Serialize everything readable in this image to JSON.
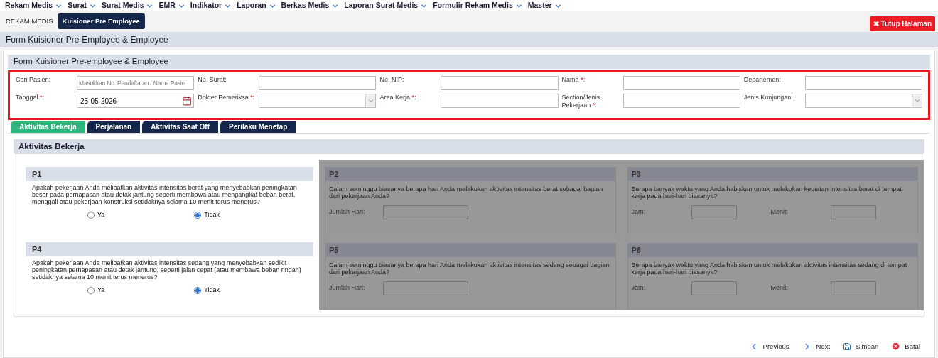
{
  "menu": [
    {
      "label": "Rekam Medis"
    },
    {
      "label": "Surat"
    },
    {
      "label": "Surat Medis"
    },
    {
      "label": "EMR"
    },
    {
      "label": "Indikator"
    },
    {
      "label": "Laporan"
    },
    {
      "label": "Berkas Medis"
    },
    {
      "label": "Laporan Surat Medis"
    },
    {
      "label": "Formulir Rekam Medis"
    },
    {
      "label": "Master"
    }
  ],
  "breadcrumb": [
    {
      "label": "REKAM MEDIS",
      "selected": false
    },
    {
      "label": "Kuisioner Pre Employee",
      "selected": true
    }
  ],
  "close_button": {
    "icon": "✖",
    "label": "Tutup Halaman"
  },
  "page_title": "Form Kuisioner Pre-Employee & Employee",
  "form": {
    "title": "Form Kuisioner Pre-employee & Employee",
    "rows": [
      [
        {
          "label": "Cari Pasien:",
          "kind": "text",
          "placeholder": "Masukkan No. Pendaftaran / Nama Pasie"
        },
        {
          "label": "No. Surat:",
          "kind": "text"
        },
        {
          "label": "No. NIP:",
          "kind": "text"
        },
        {
          "label": "Nama ",
          "mark": "*",
          "suffix": ":",
          "kind": "text"
        },
        {
          "label": "Departemen:",
          "kind": "text"
        }
      ],
      [
        {
          "label": "Tanggal ",
          "mark": "*",
          "suffix": ":",
          "kind": "date",
          "value": "25-05-2026"
        },
        {
          "label": "Dokter Pemeriksa ",
          "mark": "*",
          "suffix": ":",
          "kind": "select"
        },
        {
          "label": "Area Kerja ",
          "mark": "*",
          "suffix": ":",
          "kind": "text"
        },
        {
          "label": "Section/Jenis Pekerjaan ",
          "mark": "*",
          "suffix": ":",
          "kind": "text"
        },
        {
          "label": "Jenis Kunjungan:",
          "kind": "select"
        }
      ]
    ]
  },
  "tabs": [
    {
      "label": "Aktivitas Bekerja",
      "selected": true
    },
    {
      "label": "Perjalanan",
      "selected": false
    },
    {
      "label": "Aktivitas Saat Off",
      "selected": false
    },
    {
      "label": "Perilaku Menetap",
      "selected": false
    }
  ],
  "section": {
    "title": "Aktivitas Bekerja",
    "left": [
      {
        "code": "P1",
        "text": "Apakah pekerjaan Anda melibatkan aktivitas intensitas berat yang menyebabkan peningkatan besar pada pernapasan atau detak jantung seperti membawa atau mengangkat beban berat, menggali atau pekerjaan konstruksi setidaknya selama 10 menit terus menerus?",
        "options": [
          {
            "label": "Ya",
            "selected": false
          },
          {
            "label": "Tidak",
            "selected": true
          }
        ]
      },
      {
        "code": "P4",
        "text": "Apakah pekerjaan Anda melibatkan aktivitas intensitas sedang yang menyebabkan sedikit peningkatan pernapasan atau detak jantung, seperti jalan cepat (atau membawa beban ringan) setidaknya selama 10 menit terus menerus?",
        "options": [
          {
            "label": "Ya",
            "selected": false
          },
          {
            "label": "Tidak",
            "selected": true
          }
        ]
      }
    ],
    "right": {
      "disabled": true,
      "questions": [
        {
          "code": "P2",
          "text": "Dalam seminggu biasanya berapa hari Anda melakukan aktivitas intensitas berat sebagai bagian dari pekerjaan Anda?",
          "fields": [
            "Jumlah Hari:"
          ]
        },
        {
          "code": "P3",
          "text": "Berapa banyak waktu yang Anda habiskan untuk melakukan kegiatan intensitas berat di tempat kerja pada hari-hari biasanya?",
          "fields": [
            "Jam:",
            "Menit:"
          ]
        },
        {
          "code": "P5",
          "text": "Dalam seminggu biasanya berapa hari Anda melakukan aktivitas intensitas sedang sebagai bagian dari pekerjaan Anda?",
          "fields": [
            "Jumlah Hari:"
          ]
        },
        {
          "code": "P6",
          "text": "Berapa banyak waktu yang Anda habiskan untuk melakukan aktivitas intensitas sedang di tempat kerja pada hari-hari biasanya?",
          "fields": [
            "Jam:",
            "Menit:"
          ]
        }
      ]
    }
  },
  "footer": [
    {
      "kind": "prev",
      "label": "Previous"
    },
    {
      "kind": "next",
      "label": "Next"
    },
    {
      "kind": "save",
      "label": "Simpan"
    },
    {
      "kind": "cancel",
      "label": "Batal"
    }
  ]
}
